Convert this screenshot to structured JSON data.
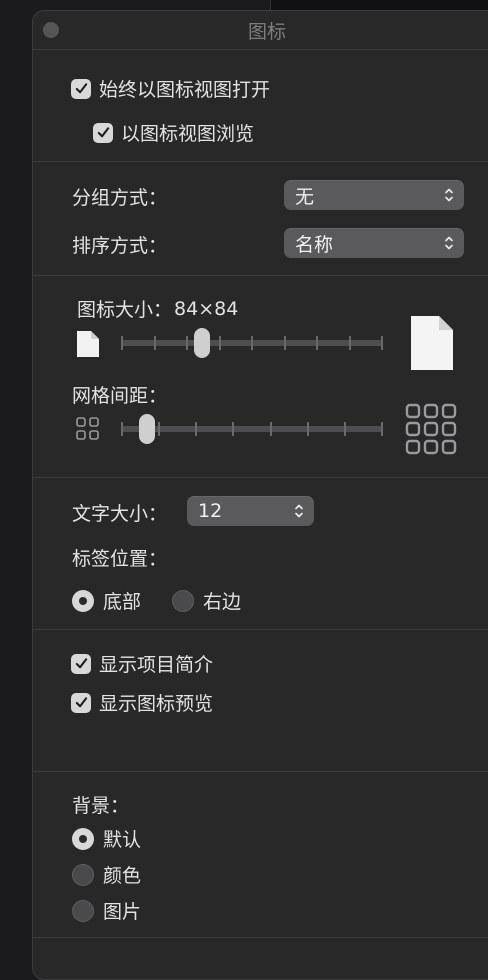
{
  "window": {
    "title": "图标"
  },
  "options": {
    "always_open_icon_view": {
      "label": "始终以图标视图打开",
      "checked": true
    },
    "browse_icon_view": {
      "label": "以图标视图浏览",
      "checked": true
    }
  },
  "grouping": {
    "label": "分组方式：",
    "value": "无"
  },
  "sorting": {
    "label": "排序方式：",
    "value": "名称"
  },
  "icon_size": {
    "label": "图标大小：",
    "value": "84×84",
    "slider_fraction": 0.31
  },
  "grid_spacing": {
    "label": "网格间距：",
    "slider_fraction": 0.1
  },
  "text_size": {
    "label": "文字大小：",
    "value": "12"
  },
  "label_position": {
    "label": "标签位置：",
    "options": [
      {
        "label": "底部",
        "selected": true
      },
      {
        "label": "右边",
        "selected": false
      }
    ]
  },
  "show_item_info": {
    "label": "显示项目简介",
    "checked": true
  },
  "show_icon_preview": {
    "label": "显示图标预览",
    "checked": true
  },
  "background": {
    "label": "背景：",
    "options": [
      {
        "label": "默认",
        "selected": true
      },
      {
        "label": "颜色",
        "selected": false
      },
      {
        "label": "图片",
        "selected": false
      }
    ]
  }
}
